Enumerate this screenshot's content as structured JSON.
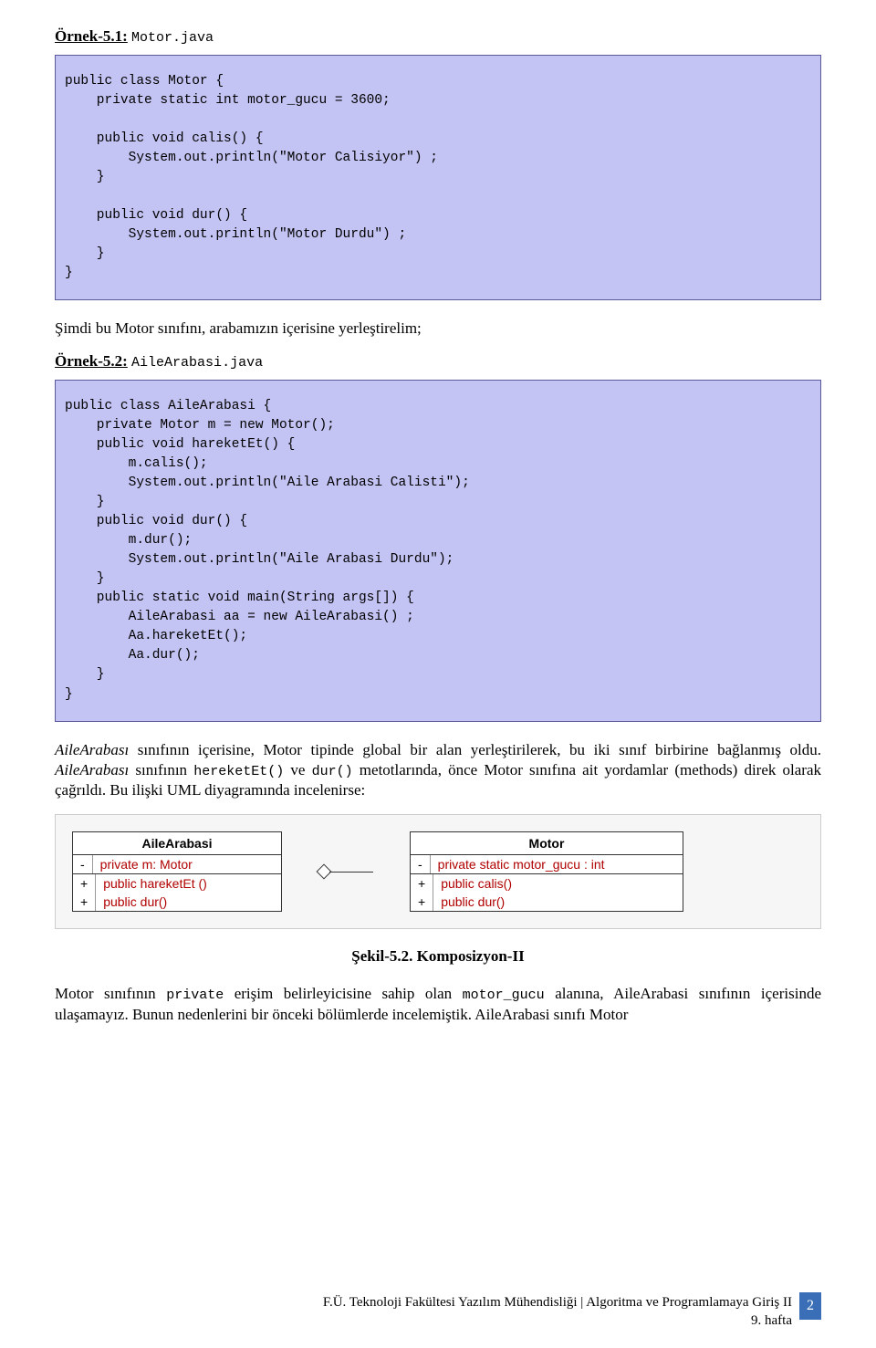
{
  "section1": {
    "label_prefix": "Örnek-5.1:",
    "filename": "Motor.java",
    "code": "public class Motor {\n    private static int motor_gucu = 3600;\n\n    public void calis() {\n        System.out.println(\"Motor Calisiyor\") ;\n    }\n\n    public void dur() {\n        System.out.println(\"Motor Durdu\") ;\n    }\n}"
  },
  "para1": "Şimdi bu Motor sınıfını, arabamızın içerisine yerleştirelim;",
  "section2": {
    "label_prefix": "Örnek-5.2:",
    "filename": "AileArabasi.java",
    "code": "public class AileArabasi {\n    private Motor m = new Motor();\n    public void hareketEt() {\n        m.calis();\n        System.out.println(\"Aile Arabasi Calisti\");\n    }\n    public void dur() {\n        m.dur();\n        System.out.println(\"Aile Arabasi Durdu\");\n    }\n    public static void main(String args[]) {\n        AileArabasi aa = new AileArabasi() ;\n        Aa.hareketEt();\n        Aa.dur();\n    }\n}"
  },
  "para2_prefix": "AileArabası",
  "para2_mid1": " sınıfının içerisine, Motor tipinde global bir alan yerleştirilerek, bu iki sınıf birbirine bağlanmış oldu. ",
  "para2_italic2": "AileArabası",
  "para2_mid2": " sınıfının ",
  "para2_code1": "hereketEt()",
  "para2_and": " ve ",
  "para2_code2": "dur()",
  "para2_tail": " metotlarında, önce Motor sınıfına ait yordamlar (methods) direk olarak çağrıldı. Bu ilişki UML diyagramında incelenirse:",
  "uml": {
    "left": {
      "name": "AileArabasi",
      "attrs": [
        {
          "vis": "-",
          "text": "private m:  Motor",
          "red": true
        }
      ],
      "ops": [
        {
          "vis": "+",
          "text": "public hareketEt ()",
          "red": true
        },
        {
          "vis": "+",
          "text": "public dur()",
          "red": true
        }
      ]
    },
    "right": {
      "name": "Motor",
      "attrs": [
        {
          "vis": "-",
          "text": "private static motor_gucu :  int",
          "red": true
        }
      ],
      "ops": [
        {
          "vis": "+",
          "text": "public calis()",
          "red": true
        },
        {
          "vis": "+",
          "text": "public dur()",
          "red": true
        }
      ]
    }
  },
  "figcaption": "Şekil-5.2.   Komposizyon-II",
  "para3_before1": "Motor sınıfının ",
  "para3_code1": "private",
  "para3_mid1": " erişim belirleyicisine sahip olan ",
  "para3_code2": "motor_gucu",
  "para3_tail": " alanına, AileArabasi sınıfının içerisinde ulaşamayız. Bunun nedenlerini bir önceki bölümlerde incelemiştik. AileArabasi sınıfı Motor",
  "footer": {
    "line1": "F.Ü. Teknoloji Fakültesi Yazılım Mühendisliği | Algoritma ve Programlamaya Giriş II",
    "line2": "9. hafta",
    "page": "2"
  }
}
